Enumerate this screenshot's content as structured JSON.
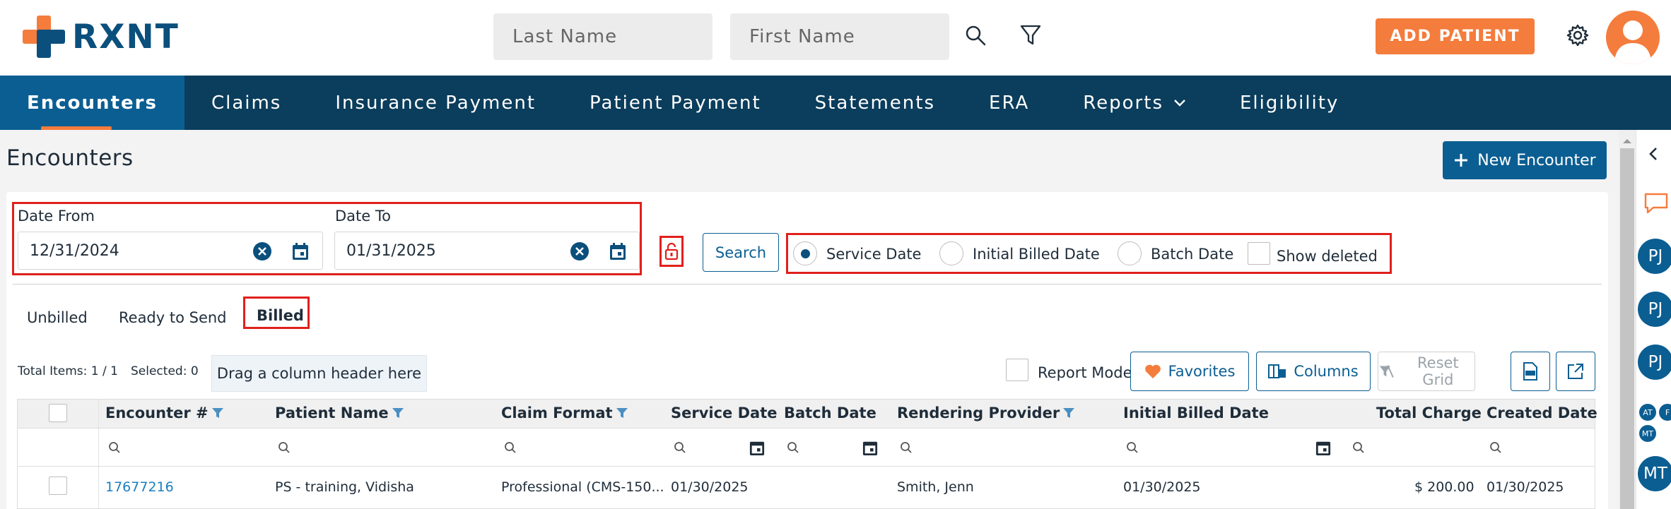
{
  "brand": {
    "name": "RXNT",
    "primary": "#0b4f7c",
    "accent": "#f47c3c"
  },
  "header": {
    "last_name_placeholder": "Last Name",
    "first_name_placeholder": "First Name",
    "add_patient_label": "ADD PATIENT"
  },
  "nav": {
    "items": [
      "Encounters",
      "Claims",
      "Insurance Payment",
      "Patient Payment",
      "Statements",
      "ERA",
      "Reports",
      "Eligibility"
    ],
    "active": "Encounters"
  },
  "page": {
    "title": "Encounters",
    "new_encounter_label": "New Encounter"
  },
  "filters": {
    "date_from_label": "Date From",
    "date_from_value": "12/31/2024",
    "date_to_label": "Date To",
    "date_to_value": "01/31/2025",
    "search_label": "Search",
    "date_types": [
      "Service Date",
      "Initial Billed Date",
      "Batch Date"
    ],
    "selected_date_type": "Service Date",
    "show_deleted_label": "Show deleted",
    "show_deleted_checked": false
  },
  "tabs": {
    "items": [
      "Unbilled",
      "Ready to Send",
      "Billed"
    ],
    "active": "Billed"
  },
  "toolbar": {
    "total_items": "Total Items: 1 / 1",
    "selected": "Selected: 0",
    "drag_hint": "Drag a column header here",
    "report_mode_label": "Report Mode",
    "favorites_label": "Favorites",
    "columns_label": "Columns",
    "reset_grid_label": "Reset Grid"
  },
  "grid": {
    "columns": [
      "Encounter #",
      "Patient Name",
      "Claim Format",
      "Service Date",
      "Batch Date",
      "Rendering Provider",
      "Initial Billed Date",
      "Total Charge",
      "Created Date"
    ],
    "rows": [
      {
        "encounter": "17677216",
        "patient_name": "PS - training, Vidisha",
        "claim_format": "Professional (CMS-150...",
        "service_date": "01/30/2025",
        "batch_date": "",
        "rendering_provider": "Smith, Jenn",
        "initial_billed_date": "01/30/2025",
        "total_charge": "$ 200.00",
        "created_date": "01/30/2025"
      }
    ]
  },
  "rail": {
    "avatars": [
      "PJ",
      "PJ",
      "PJ",
      "AT",
      "F",
      "MT",
      "MT"
    ]
  }
}
